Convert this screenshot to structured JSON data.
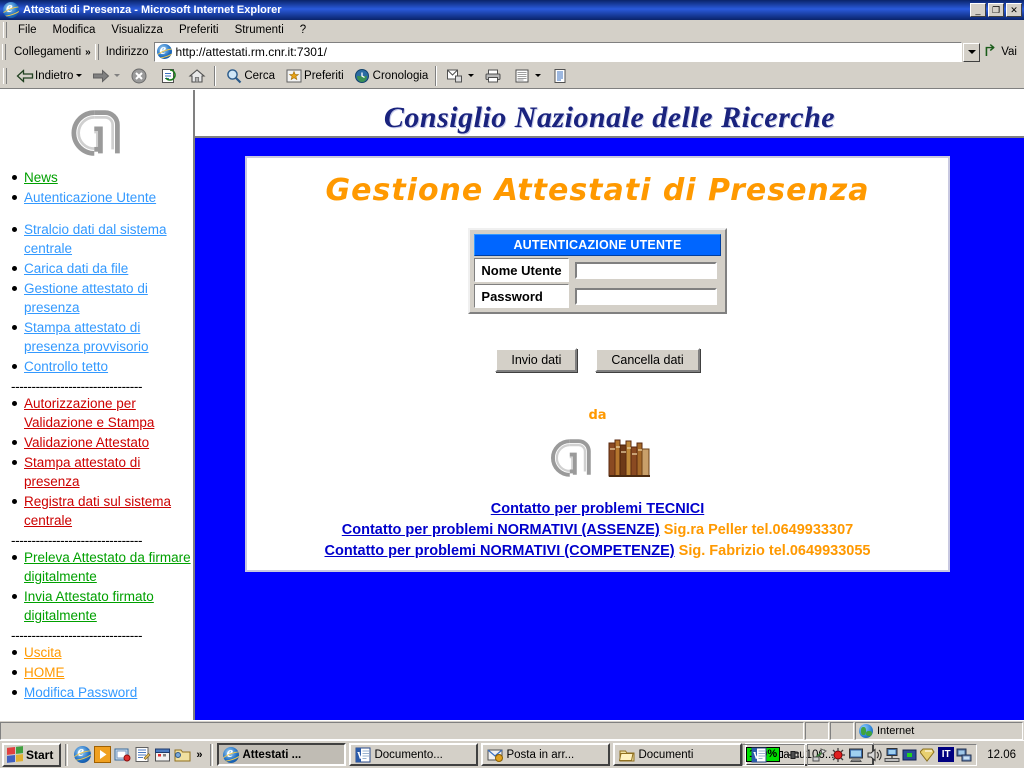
{
  "window": {
    "title": "Attestati di Presenza - Microsoft Internet Explorer",
    "min_label": "_",
    "restore_label": "❐",
    "close_label": "✕"
  },
  "menubar": {
    "items": [
      "File",
      "Modifica",
      "Visualizza",
      "Preferiti",
      "Strumenti",
      "?"
    ]
  },
  "addressbar": {
    "links_label": "Collegamenti",
    "links_chevron": "»",
    "address_label": "Indirizzo",
    "url": "http://attestati.rm.cnr.it:7301/",
    "go_label": "Vai"
  },
  "toolbar": {
    "back": "Indietro",
    "forward": "",
    "stop": "",
    "refresh": "",
    "home": "",
    "search": "Cerca",
    "favorites": "Preferiti",
    "history": "Cronologia",
    "mail": "",
    "print": "",
    "edit": ""
  },
  "sidebar": {
    "logo_alt": "cnr-logo",
    "items": [
      {
        "label": "News",
        "color": "lnk-green",
        "type": "link"
      },
      {
        "label": "Autenticazione Utente",
        "color": "lnk-blue",
        "type": "link"
      },
      {
        "type": "spacer"
      },
      {
        "label": "Stralcio dati dal sistema centrale",
        "color": "lnk-blue",
        "type": "link"
      },
      {
        "label": "Carica dati da file",
        "color": "lnk-blue",
        "type": "link"
      },
      {
        "label": "Gestione attestato di presenza",
        "color": "lnk-blue",
        "type": "link"
      },
      {
        "label": "Stampa attestato di presenza provvisorio",
        "color": "lnk-blue",
        "type": "link"
      },
      {
        "label": "Controllo tetto",
        "color": "lnk-blue",
        "type": "link"
      },
      {
        "type": "divider",
        "label": "--------------------------------"
      },
      {
        "label": "Autorizzazione per Validazione e Stampa",
        "color": "lnk-red",
        "type": "link"
      },
      {
        "label": "Validazione Attestato",
        "color": "lnk-red",
        "type": "link"
      },
      {
        "label": "Stampa attestato di presenza",
        "color": "lnk-red",
        "type": "link"
      },
      {
        "label": "Registra dati sul sistema centrale",
        "color": "lnk-red",
        "type": "link"
      },
      {
        "type": "divider",
        "label": "--------------------------------"
      },
      {
        "label": "Preleva Attestato da firmare digitalmente",
        "color": "lnk-green",
        "type": "link"
      },
      {
        "label": "Invia Attestato firmato digitalmente",
        "color": "lnk-green",
        "type": "link"
      },
      {
        "type": "divider",
        "label": "--------------------------------"
      },
      {
        "label": "Uscita",
        "color": "lnk-orange",
        "type": "link"
      },
      {
        "label": "HOME",
        "color": "lnk-orange",
        "type": "link"
      },
      {
        "label": "Modifica Password",
        "color": "lnk-blue",
        "type": "link"
      }
    ]
  },
  "banner": {
    "text": "Consiglio Nazionale delle Ricerche"
  },
  "page": {
    "heading": "Gestione Attestati di Presenza",
    "form": {
      "header": "AUTENTICAZIONE UTENTE",
      "username_label": "Nome Utente",
      "username_value": "",
      "password_label": "Password",
      "password_value": "",
      "submit_label": "Invio dati",
      "reset_label": "Cancella dati"
    },
    "credit_label": "da",
    "contacts": [
      {
        "link": "Contatto per problemi TECNICI",
        "extra": ""
      },
      {
        "link": "Contatto per problemi NORMATIVI (ASSENZE)",
        "extra": "Sig.ra Peller tel.0649933307"
      },
      {
        "link": "Contatto per problemi NORMATIVI (COMPETENZE)",
        "extra": "Sig. Fabrizio tel.0649933055"
      }
    ]
  },
  "statusbar": {
    "message": "",
    "zone": "Internet"
  },
  "taskbar": {
    "start_label": "Start",
    "quicklaunch_chevron": "»",
    "tasks": [
      {
        "label": "Attestati ...",
        "icon": "ie-icon",
        "active": true
      },
      {
        "label": "Documento...",
        "icon": "word-icon",
        "active": false
      },
      {
        "label": "Posta in arr...",
        "icon": "outlook-icon",
        "active": false
      },
      {
        "label": "Documenti",
        "icon": "folder-icon",
        "active": false
      },
      {
        "label": "npamu106....",
        "icon": "word-icon",
        "active": false
      }
    ],
    "battery_level": "100%",
    "language": "IT",
    "clock": "12.06"
  },
  "colors": {
    "page_background": "#0000FF",
    "heading": "#FF9900",
    "form_header": "#0066FF",
    "link_blue": "#3399FF",
    "link_green": "#00A000",
    "link_red": "#CC0000",
    "link_orange": "#FF9900",
    "banner_text": "#1A237E",
    "titlebar": "#0A246A"
  }
}
